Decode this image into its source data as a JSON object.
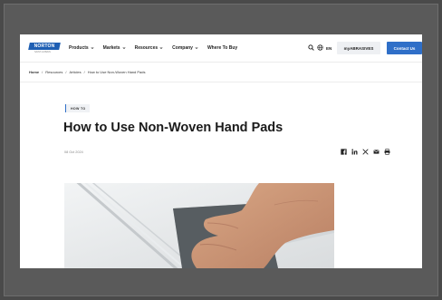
{
  "header": {
    "logo_text": "NORTON",
    "logo_subtext": "SAINT-GOBAIN",
    "nav": [
      {
        "label": "Products"
      },
      {
        "label": "Markets"
      },
      {
        "label": "Resources"
      },
      {
        "label": "Company"
      },
      {
        "label": "Where To Buy"
      }
    ],
    "lang": "EN",
    "my_button": "myABRASIVES",
    "contact_button": "Contact Us"
  },
  "breadcrumb": [
    "Home",
    "Resources",
    "Articles",
    "How to Use Non-Woven Hand Pads"
  ],
  "breadcrumb_separator": "/",
  "article": {
    "tag": "HOW TO",
    "title": "How to Use Non-Woven Hand Pads",
    "date": "08 Oct 2024"
  },
  "colors": {
    "brand_blue": "#2f6fc8",
    "logo_blue": "#1f5fb3"
  }
}
